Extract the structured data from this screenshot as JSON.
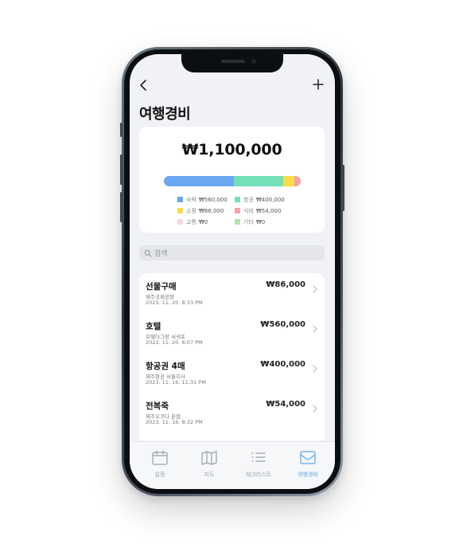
{
  "page": {
    "title": "여행경비",
    "back_icon": "chevron-left-icon",
    "add_icon": "plus-icon"
  },
  "summary": {
    "total": "₩1,100,000",
    "bar": [
      {
        "category": "숙박",
        "fraction": 0.509,
        "color": "#6aa8f2"
      },
      {
        "category": "항공",
        "fraction": 0.364,
        "color": "#74e0b8"
      },
      {
        "category": "쇼핑",
        "fraction": 0.078,
        "color": "#f9dc4a"
      },
      {
        "category": "식비",
        "fraction": 0.049,
        "color": "#f5a3a8"
      }
    ],
    "legend": [
      {
        "name": "숙박",
        "amount": "₩560,000",
        "color": "#6aa8f2"
      },
      {
        "name": "항공",
        "amount": "₩400,000",
        "color": "#74e0b8"
      },
      {
        "name": "쇼핑",
        "amount": "₩86,000",
        "color": "#f9dc4a"
      },
      {
        "name": "식비",
        "amount": "₩54,000",
        "color": "#f5a3a8"
      },
      {
        "name": "교통",
        "amount": "₩0",
        "color": "#fbd3e2"
      },
      {
        "name": "기타",
        "amount": "₩0",
        "color": "#b4e3a6"
      }
    ]
  },
  "search": {
    "placeholder": "검색",
    "icon": "search-icon"
  },
  "expenses": [
    {
      "name": "선물구매",
      "place": "제주국제공항",
      "datetime": "2023. 11. 20. 8:33 PM",
      "amount": "₩86,000"
    },
    {
      "name": "호텔",
      "place": "호텔더그랑 서귀포",
      "datetime": "2023. 11. 20. 6:07 PM",
      "amount": "₩560,000"
    },
    {
      "name": "항공권 4매",
      "place": "제주항공 서울지사",
      "datetime": "2023. 11. 16. 11:31 PM",
      "amount": "₩400,000"
    },
    {
      "name": "전복죽",
      "place": "제주오쿠다 본점",
      "datetime": "2023. 11. 16. 8:32 PM",
      "amount": "₩54,000"
    }
  ],
  "tabs": [
    {
      "label": "일정",
      "icon": "calendar-icon",
      "active": false
    },
    {
      "label": "지도",
      "icon": "map-icon",
      "active": false
    },
    {
      "label": "체크리스트",
      "icon": "list-icon",
      "active": false
    },
    {
      "label": "여행경비",
      "icon": "wallet-icon",
      "active": true
    }
  ],
  "colors": {
    "accent": "#5aa7e8",
    "background": "#f1f2f5"
  }
}
